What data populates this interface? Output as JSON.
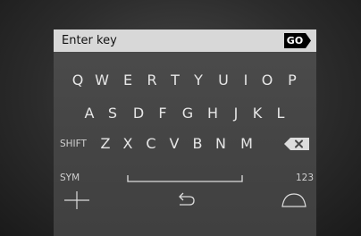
{
  "input": {
    "placeholder": "Enter key",
    "go_label": "GO"
  },
  "keyboard": {
    "row1": [
      "Q",
      "W",
      "E",
      "R",
      "T",
      "Y",
      "U",
      "I",
      "O",
      "P"
    ],
    "row2": [
      "A",
      "S",
      "D",
      "F",
      "G",
      "H",
      "J",
      "K",
      "L"
    ],
    "row3": [
      "Z",
      "X",
      "C",
      "V",
      "B",
      "N",
      "M"
    ],
    "shift_label": "SHIFT",
    "sym_label": "SYM",
    "num_label": "123"
  },
  "icons": {
    "backspace": "backspace-icon",
    "space": "space-bar-icon",
    "plus": "plus-icon",
    "back": "undo-arrow-icon",
    "arc": "arc-icon"
  },
  "colors": {
    "input_bg": "#d8d8d8",
    "key_text": "#e6e6e6",
    "screen_bg": "#474747"
  }
}
